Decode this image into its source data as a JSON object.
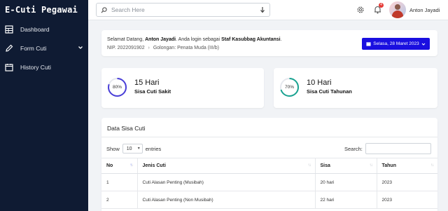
{
  "sidebar": {
    "brand": "E-Cuti Pegawai",
    "items": [
      {
        "label": "Dashboard",
        "icon": "dashboard-icon"
      },
      {
        "label": "Form Cuti",
        "icon": "pencil-icon",
        "has_submenu": true
      },
      {
        "label": "History Cuti",
        "icon": "calendar-icon"
      }
    ]
  },
  "topbar": {
    "search_placeholder": "Search Here",
    "notification_count": "4",
    "user_name": "Anton Jayadi"
  },
  "welcome": {
    "prefix": "Selamat Datang,",
    "name": "Anton Jayadi",
    "middle": ". Anda login sebagai",
    "role": "Staf Kasubbag Akuntansi",
    "suffix": ".",
    "nip": "NIP. 2022091902",
    "separator": "›",
    "golongan": "Golongan: Penata Muda (III/b)",
    "date_button": "Selasa, 28 Maret 2023"
  },
  "stats": [
    {
      "percent_label": "80%",
      "percent": 80,
      "title": "15 Hari",
      "subtitle": "Sisa Cuti Sakit",
      "color": "#4a3fd8"
    },
    {
      "percent_label": "70%",
      "percent": 70,
      "title": "10 Hari",
      "subtitle": "Sisa Cuti Tahunan",
      "color": "#1aa391"
    }
  ],
  "table": {
    "title": "Data Sisa Cuti",
    "show_label": "Show",
    "entries_value": "10",
    "entries_label": "entries",
    "search_label": "Search:",
    "headers": [
      "No",
      "Jenis Cuti",
      "Sisa",
      "Tahun"
    ],
    "rows": [
      [
        "1",
        "Cuti Alasan Penting (Musibah)",
        "20 hari",
        "2023"
      ],
      [
        "2",
        "Cuti Alasan Penting (Non Musibah)",
        "22 hari",
        "2023"
      ]
    ]
  },
  "colors": {
    "sidebar_bg": "#0f1b33",
    "accent": "#1a0fe0",
    "badge": "#e53935"
  }
}
